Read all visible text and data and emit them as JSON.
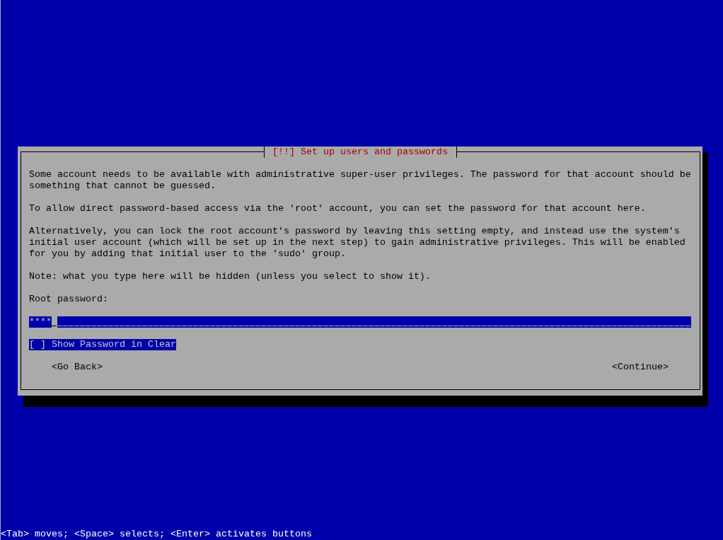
{
  "dialog": {
    "title": "[!!] Set up users and passwords",
    "paragraphs": [
      "Some account needs to be available with administrative super-user privileges. The password for that account should be something that cannot be guessed.",
      "To allow direct password-based access via the 'root' account, you can set the password for that account here.",
      "Alternatively, you can lock the root account's password by leaving this setting empty, and instead use the system's initial user account (which will be set up in the next step) to gain administrative privileges. This will be enabled for you by adding that initial user to the 'sudo' group.",
      "Note: what you type here will be hidden (unless you select to show it)."
    ],
    "field": {
      "label": "Root password:",
      "value": "****"
    },
    "checkbox": {
      "box": "[ ]",
      "label": "Show Password in Clear",
      "checked": false
    },
    "buttons": [
      "<Go Back>",
      "<Continue>"
    ]
  },
  "status_bar": "<Tab> moves; <Space> selects; <Enter> activates buttons"
}
